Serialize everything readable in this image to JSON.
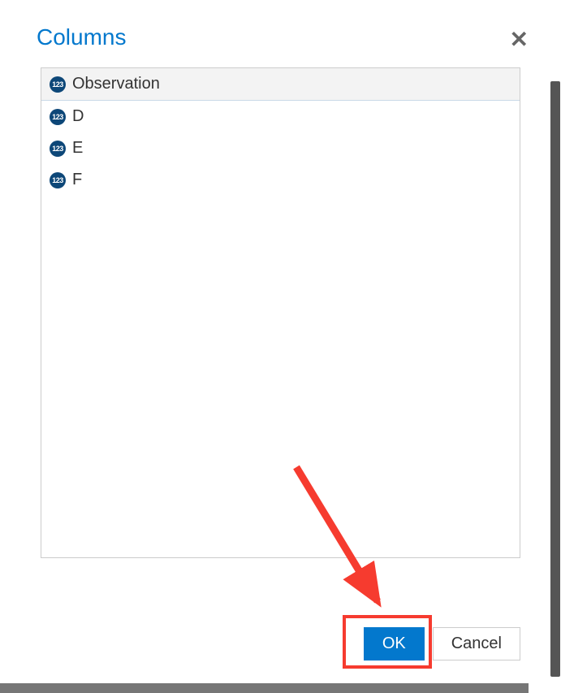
{
  "dialog": {
    "title": "Columns",
    "items": [
      {
        "icon": "123",
        "label": "Observation",
        "selected": true
      },
      {
        "icon": "123",
        "label": "D",
        "selected": false
      },
      {
        "icon": "123",
        "label": "E",
        "selected": false
      },
      {
        "icon": "123",
        "label": "F",
        "selected": false
      }
    ],
    "ok_label": "OK",
    "cancel_label": "Cancel"
  }
}
